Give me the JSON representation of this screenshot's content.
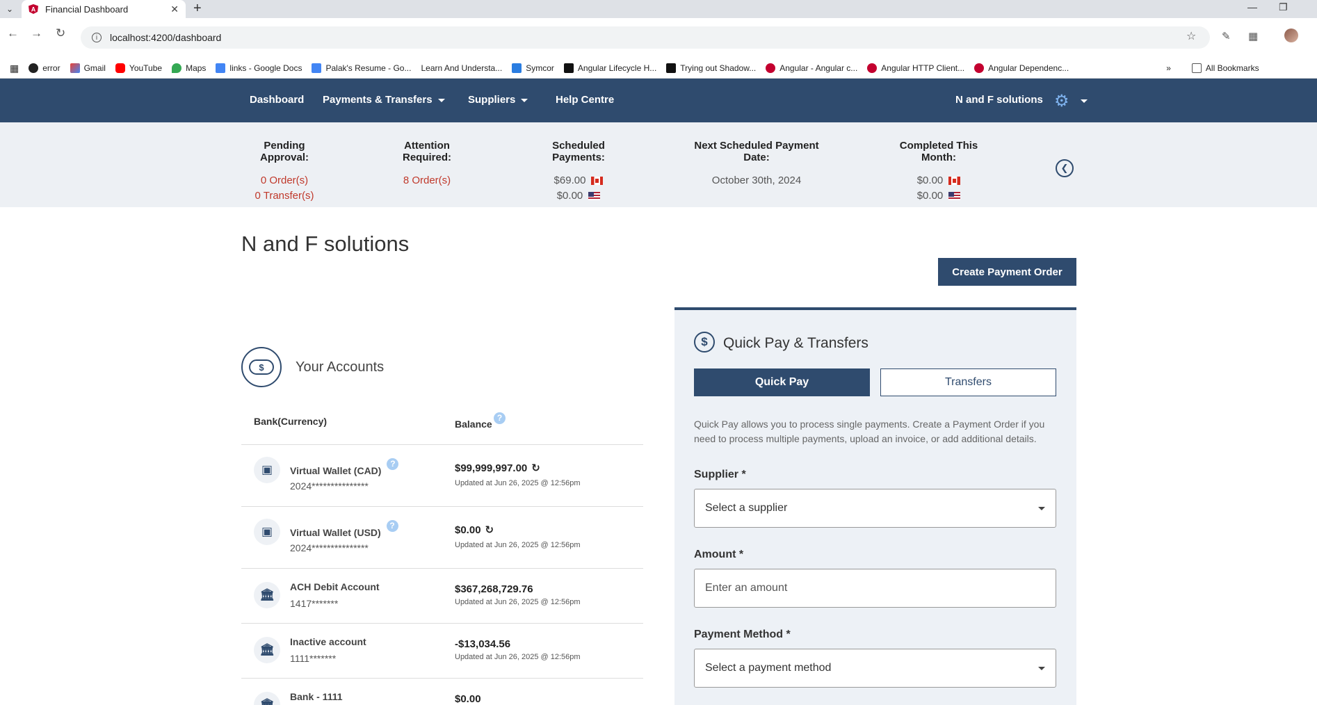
{
  "browser": {
    "tab_title": "Financial Dashboard",
    "url": "localhost:4200/dashboard",
    "bookmarks": [
      "error",
      "Gmail",
      "YouTube",
      "Maps",
      "links - Google Docs",
      "Palak's Resume - Go...",
      "Learn And Understa...",
      "Symcor",
      "Angular Lifecycle H...",
      "Trying out Shadow...",
      "Angular - Angular c...",
      "Angular HTTP Client...",
      "Angular Dependenc..."
    ],
    "all_bookmarks": "All Bookmarks"
  },
  "nav": {
    "dashboard": "Dashboard",
    "payments": "Payments & Transfers",
    "suppliers": "Suppliers",
    "help": "Help Centre",
    "company": "N and F solutions"
  },
  "summary": {
    "pending": {
      "label": "Pending Approval:",
      "orders": "0 Order(s)",
      "transfers": "0 Transfer(s)"
    },
    "attention": {
      "label": "Attention Required:",
      "orders": "8 Order(s)"
    },
    "scheduled": {
      "label": "Scheduled Payments:",
      "cad": "$69.00",
      "usd": "$0.00"
    },
    "next_date": {
      "label": "Next Scheduled Payment Date:",
      "value": "October 30th, 2024"
    },
    "completed": {
      "label": "Completed This Month:",
      "cad": "$0.00",
      "usd": "$0.00"
    }
  },
  "main": {
    "company_title": "N and F solutions",
    "create_button": "Create Payment Order"
  },
  "accounts": {
    "title": "Your Accounts",
    "icon_symbol": "$",
    "col_bank": "Bank(Currency)",
    "col_balance": "Balance",
    "rows": [
      {
        "name": "Virtual Wallet (CAD)",
        "number": "2024***************",
        "balance": "$99,999,997.00",
        "updated": "Updated at Jun 26, 2025 @ 12:56pm"
      },
      {
        "name": "Virtual Wallet (USD)",
        "number": "2024***************",
        "balance": "$0.00",
        "updated": "Updated at Jun 26, 2025 @ 12:56pm"
      },
      {
        "name": "ACH Debit Account",
        "number": "1417*******",
        "balance": "$367,268,729.76",
        "updated": "Updated at Jun 26, 2025 @ 12:56pm"
      },
      {
        "name": "Inactive account",
        "number": "1111*******",
        "balance": "-$13,034.56",
        "updated": "Updated at Jun 26, 2025 @ 12:56pm"
      },
      {
        "name": "Bank - 1111",
        "balance": "$0.00"
      }
    ]
  },
  "quickpay": {
    "title": "Quick Pay & Transfers",
    "icon_symbol": "$",
    "tab_quickpay": "Quick Pay",
    "tab_transfers": "Transfers",
    "description": "Quick Pay allows you to process single payments. Create a Payment Order if you need to process multiple payments, upload an invoice, or add additional details.",
    "supplier_label": "Supplier *",
    "supplier_value": "Select a supplier",
    "amount_label": "Amount *",
    "amount_placeholder": "Enter an amount",
    "method_label": "Payment Method *",
    "method_value": "Select a payment method"
  },
  "colors": {
    "navy": "#2f4b6e",
    "alert_red": "#c0392b",
    "summary_bg": "#edf0f4"
  }
}
